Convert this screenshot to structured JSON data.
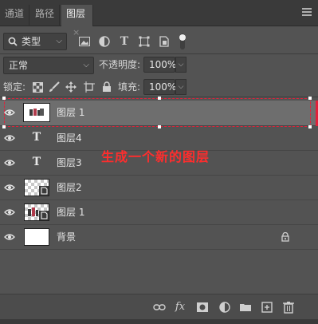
{
  "tabs": [
    {
      "label": "通道"
    },
    {
      "label": "路径"
    },
    {
      "label": "图层",
      "close": "×"
    }
  ],
  "filter": {
    "label": "类型",
    "prefix_icon": "search-icon"
  },
  "blend": {
    "mode": "正常",
    "opacity_label": "不透明度:",
    "opacity_value": "100%"
  },
  "lock_row": {
    "label": "锁定:",
    "fill_label": "填充:",
    "fill_value": "100%"
  },
  "layers": [
    {
      "name": "图层 1",
      "type": "image",
      "selected": true
    },
    {
      "name": "图层4",
      "type": "text",
      "glyph": "T"
    },
    {
      "name": "图层3",
      "type": "text",
      "glyph": "T"
    },
    {
      "name": "图层2",
      "type": "image-transparent"
    },
    {
      "name": "图层 1",
      "type": "image-transparent"
    },
    {
      "name": "背景",
      "type": "background",
      "locked": true
    }
  ],
  "annotation": "生成一个新的图层",
  "colors": {
    "accent": "#e2203a",
    "panel": "#535353",
    "selected_row": "#6e6e6e"
  },
  "footer_icons": [
    "link-icon",
    "fx-icon",
    "mask-icon",
    "adjustment-icon",
    "folder-icon",
    "new-layer-icon",
    "trash-icon"
  ],
  "footer_fx": "fx"
}
